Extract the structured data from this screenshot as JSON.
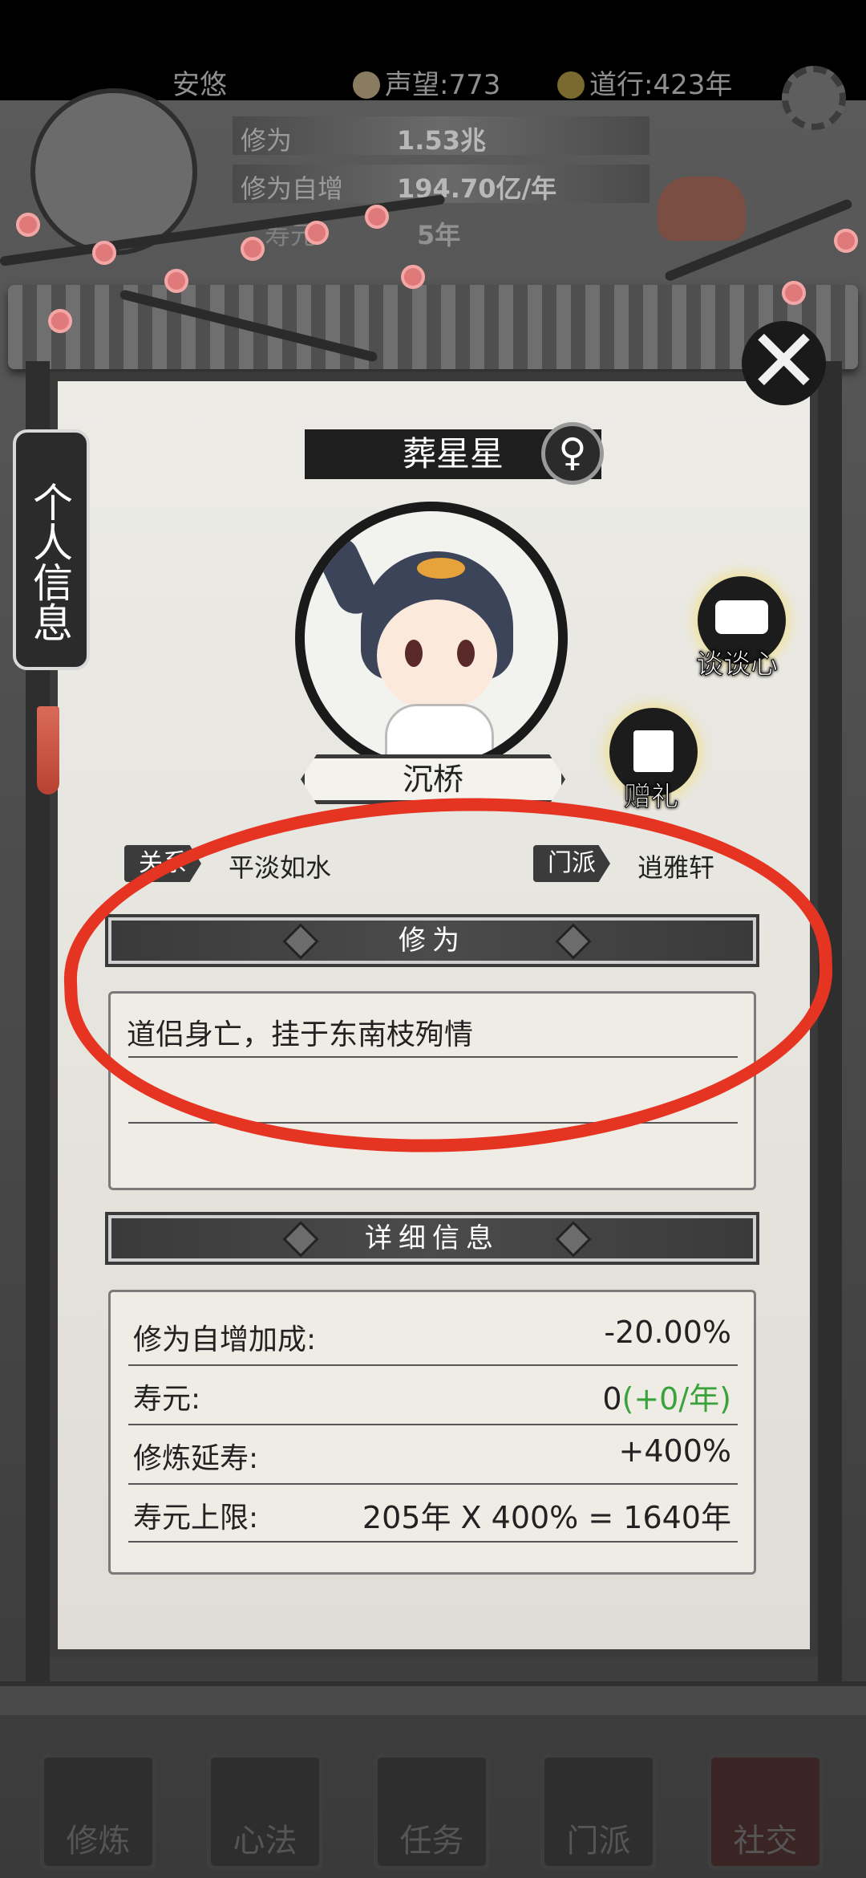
{
  "status": {
    "username": "安悠",
    "reputation": "声望:773",
    "daoxing": "道行:423年"
  },
  "bg_stats": {
    "cultivation_label": "修为",
    "cultivation_value": "1.53兆",
    "growth_label": "修为自增",
    "growth_value": "194.70亿/年",
    "partial_label": "寿元",
    "partial_value": "5年"
  },
  "side_tab": {
    "label": "个人信息"
  },
  "character": {
    "name": "葬星星",
    "gender_symbol": "♀",
    "title": "沉桥"
  },
  "actions": {
    "chat_label": "谈谈心",
    "gift_label": "赠礼"
  },
  "info": {
    "relation_tab": "关系",
    "relation_value": "平淡如水",
    "sect_tab": "门派",
    "sect_value": "逍雅轩"
  },
  "cultivation_section": {
    "title": "修为",
    "text": "道侣身亡，挂于东南枝殉情"
  },
  "detail_section": {
    "title": "详细信息",
    "rows": [
      {
        "label": "修为自增加成:",
        "value": "-20.00%"
      },
      {
        "label": "寿元:",
        "value": "0",
        "extra": "(+0/年)"
      },
      {
        "label": "修炼延寿:",
        "value": "+400%"
      },
      {
        "label": "寿元上限:",
        "value": "205年 X 400% = 1640年"
      }
    ]
  },
  "bottom_nav": [
    {
      "label": "修炼"
    },
    {
      "label": "心法"
    },
    {
      "label": "任务"
    },
    {
      "label": "门派"
    },
    {
      "label": "社交"
    }
  ],
  "colors": {
    "annotation": "#e63423",
    "positive": "#3aa23a",
    "glow": "#efe3a4"
  }
}
